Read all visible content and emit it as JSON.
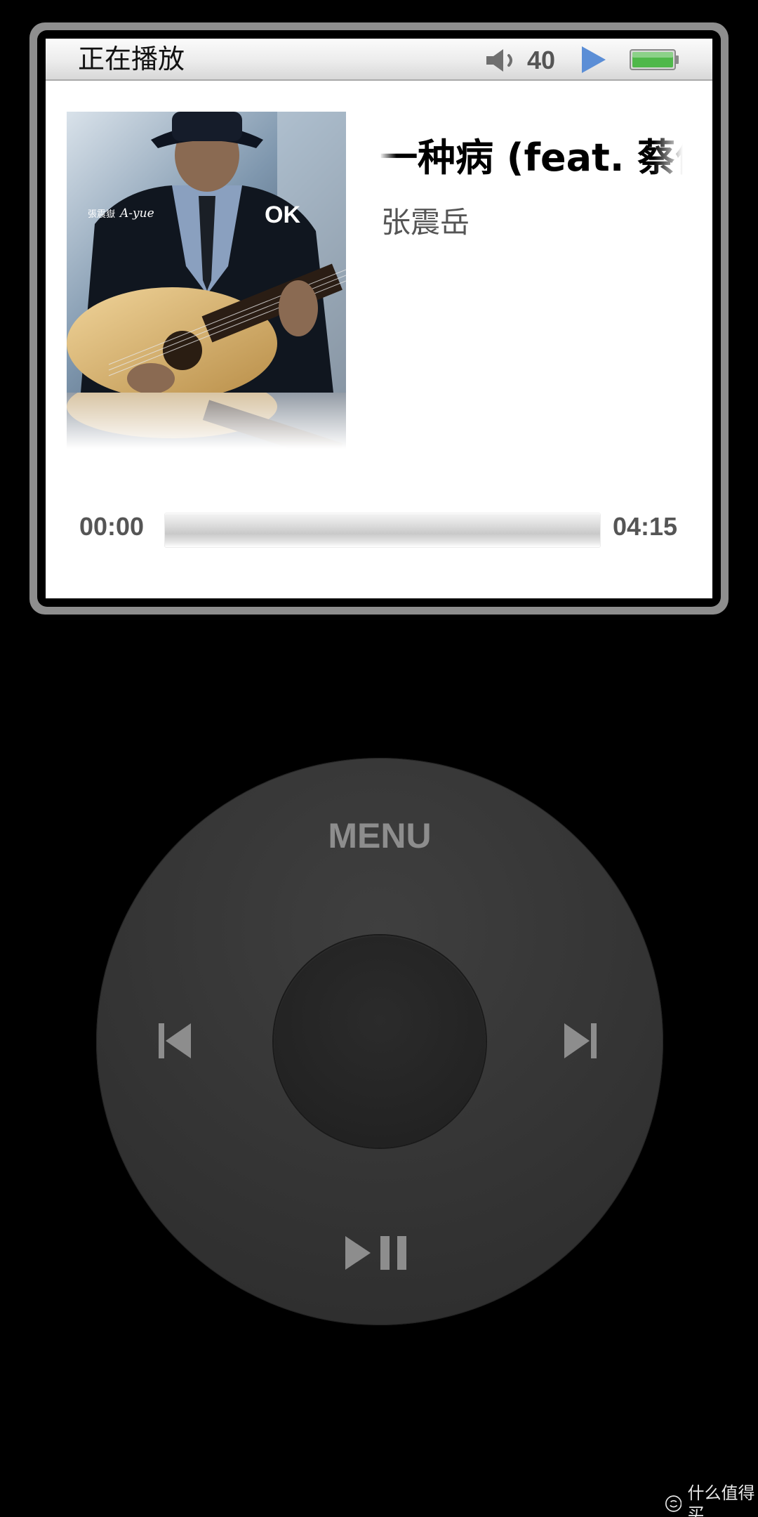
{
  "status_bar": {
    "title": "正在播放",
    "volume": "40",
    "icons": {
      "volume": "speaker-icon",
      "playing": "play-indicator-icon",
      "battery": "battery-icon"
    },
    "colors": {
      "play_indicator": "#5b8ed6",
      "battery_fill": "#4fb84a"
    }
  },
  "now_playing": {
    "title": "一种病 (feat. 蔡依林)",
    "artist": "张震岳",
    "album_art": {
      "artist_text": "張震嶽",
      "signature_text": "A-yue",
      "album_text": "OK"
    }
  },
  "progress": {
    "elapsed": "00:00",
    "total": "04:15",
    "fraction": 0.0
  },
  "click_wheel": {
    "menu_label": "MENU",
    "icons": {
      "previous": "previous-track-icon",
      "next": "next-track-icon",
      "play_pause": "play-pause-icon",
      "center": "select-button"
    }
  },
  "watermark": {
    "text": "什么值得买",
    "icon": "smzdm-logo-icon"
  }
}
